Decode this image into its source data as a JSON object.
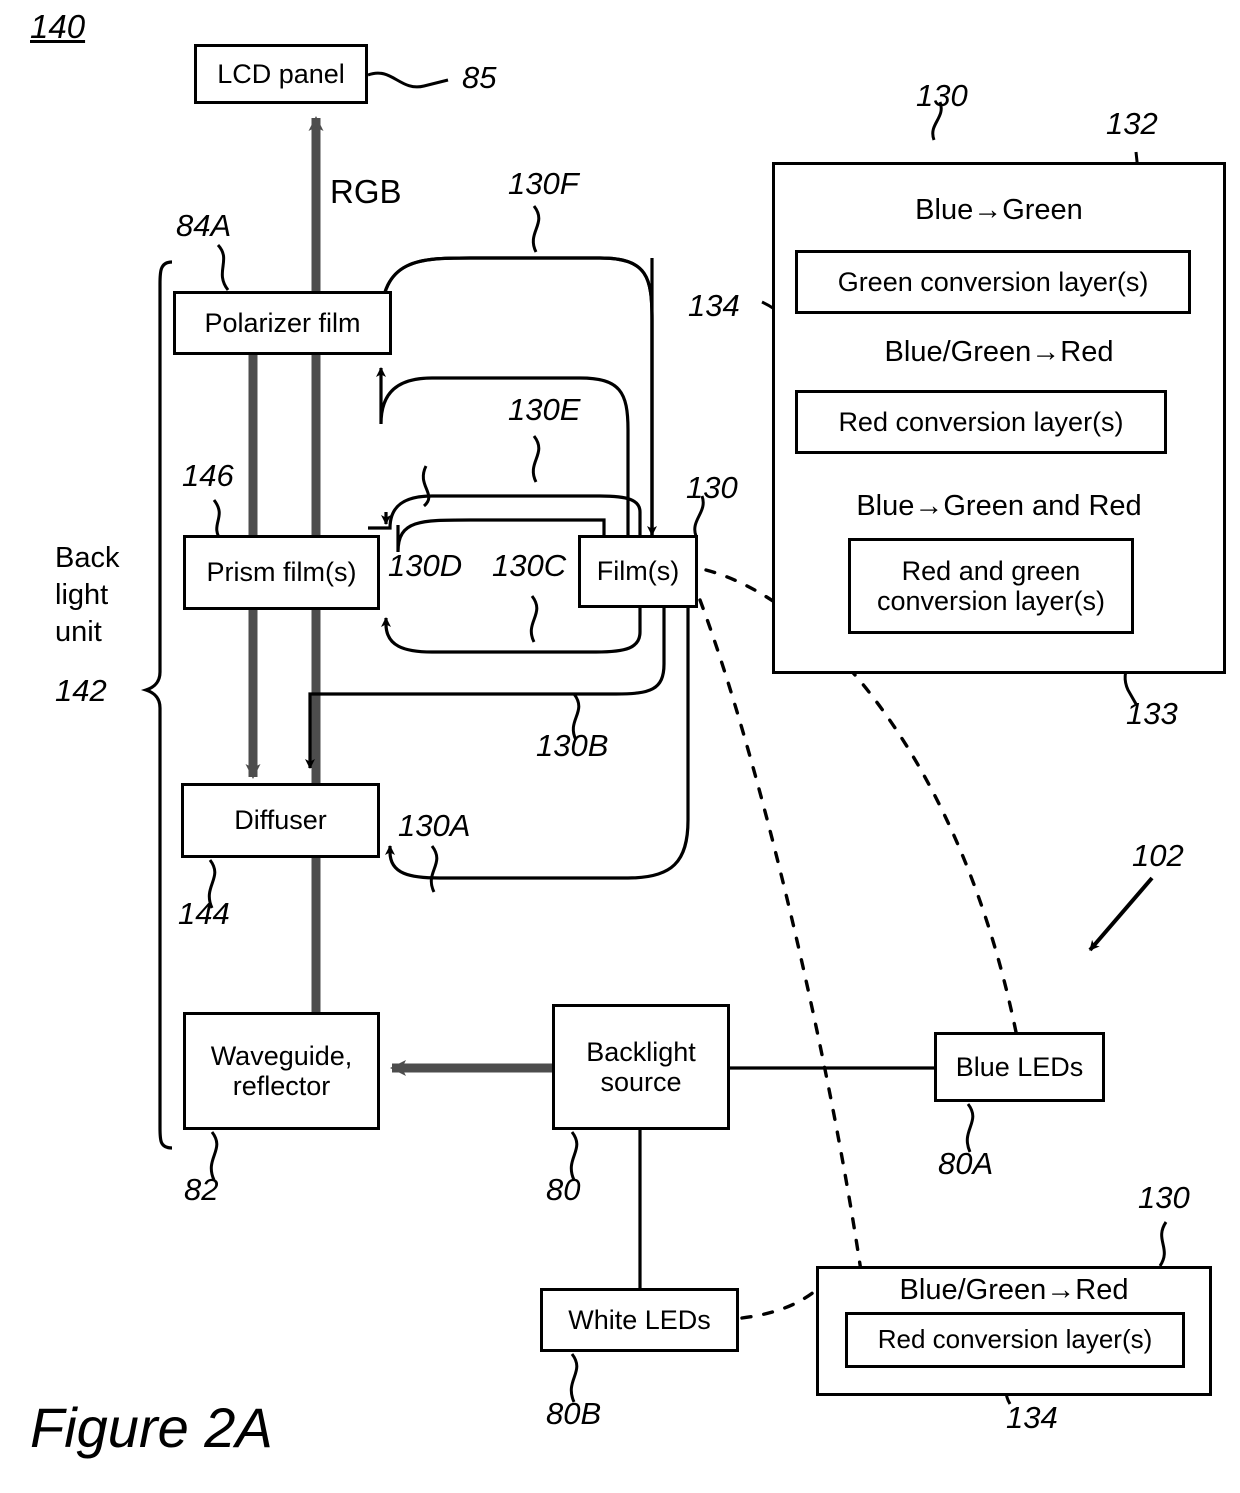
{
  "figure": {
    "number": "140",
    "caption": "Figure 2A"
  },
  "blocks": {
    "lcd_panel": "LCD panel",
    "polarizer_film": "Polarizer film",
    "prism_films": "Prism film(s)",
    "diffuser": "Diffuser",
    "waveguide_reflector": "Waveguide,\nreflector",
    "films": "Film(s)",
    "backlight_source": "Backlight\nsource",
    "blue_leds": "Blue LEDs",
    "white_leds": "White LEDs"
  },
  "conversion_panel": {
    "title_blue_to_green": "Blue→Green",
    "green_conversion_layer": "Green conversion layer(s)",
    "title_blue_green_to_red": "Blue/Green→Red",
    "red_conversion_layer": "Red conversion layer(s)",
    "title_blue_to_green_and_red": "Blue→Green and Red",
    "red_and_green_conversion_layer": "Red and green\nconversion layer(s)"
  },
  "bottom_conversion_panel": {
    "title_blue_green_to_red": "Blue/Green→Red",
    "red_conversion_layer": "Red conversion layer(s)"
  },
  "signals": {
    "rgb": "RGB"
  },
  "bracket": {
    "label": "Back\nlight\nunit",
    "number": "142"
  },
  "reference_numerals": {
    "n85": "85",
    "n84A": "84A",
    "n146": "146",
    "n144": "144",
    "n82": "82",
    "n80": "80",
    "n80A": "80A",
    "n80B": "80B",
    "n102": "102",
    "n130": "130",
    "n130_panel": "130",
    "n130_bottom": "130",
    "n130A": "130A",
    "n130B": "130B",
    "n130C": "130C",
    "n130D": "130D",
    "n130E": "130E",
    "n130F": "130F",
    "n132": "132",
    "n133": "133",
    "n134_top": "134",
    "n134_bottom": "134"
  },
  "colors": {
    "ink": "#000000",
    "paper": "#ffffff",
    "light_path": "#555555"
  }
}
